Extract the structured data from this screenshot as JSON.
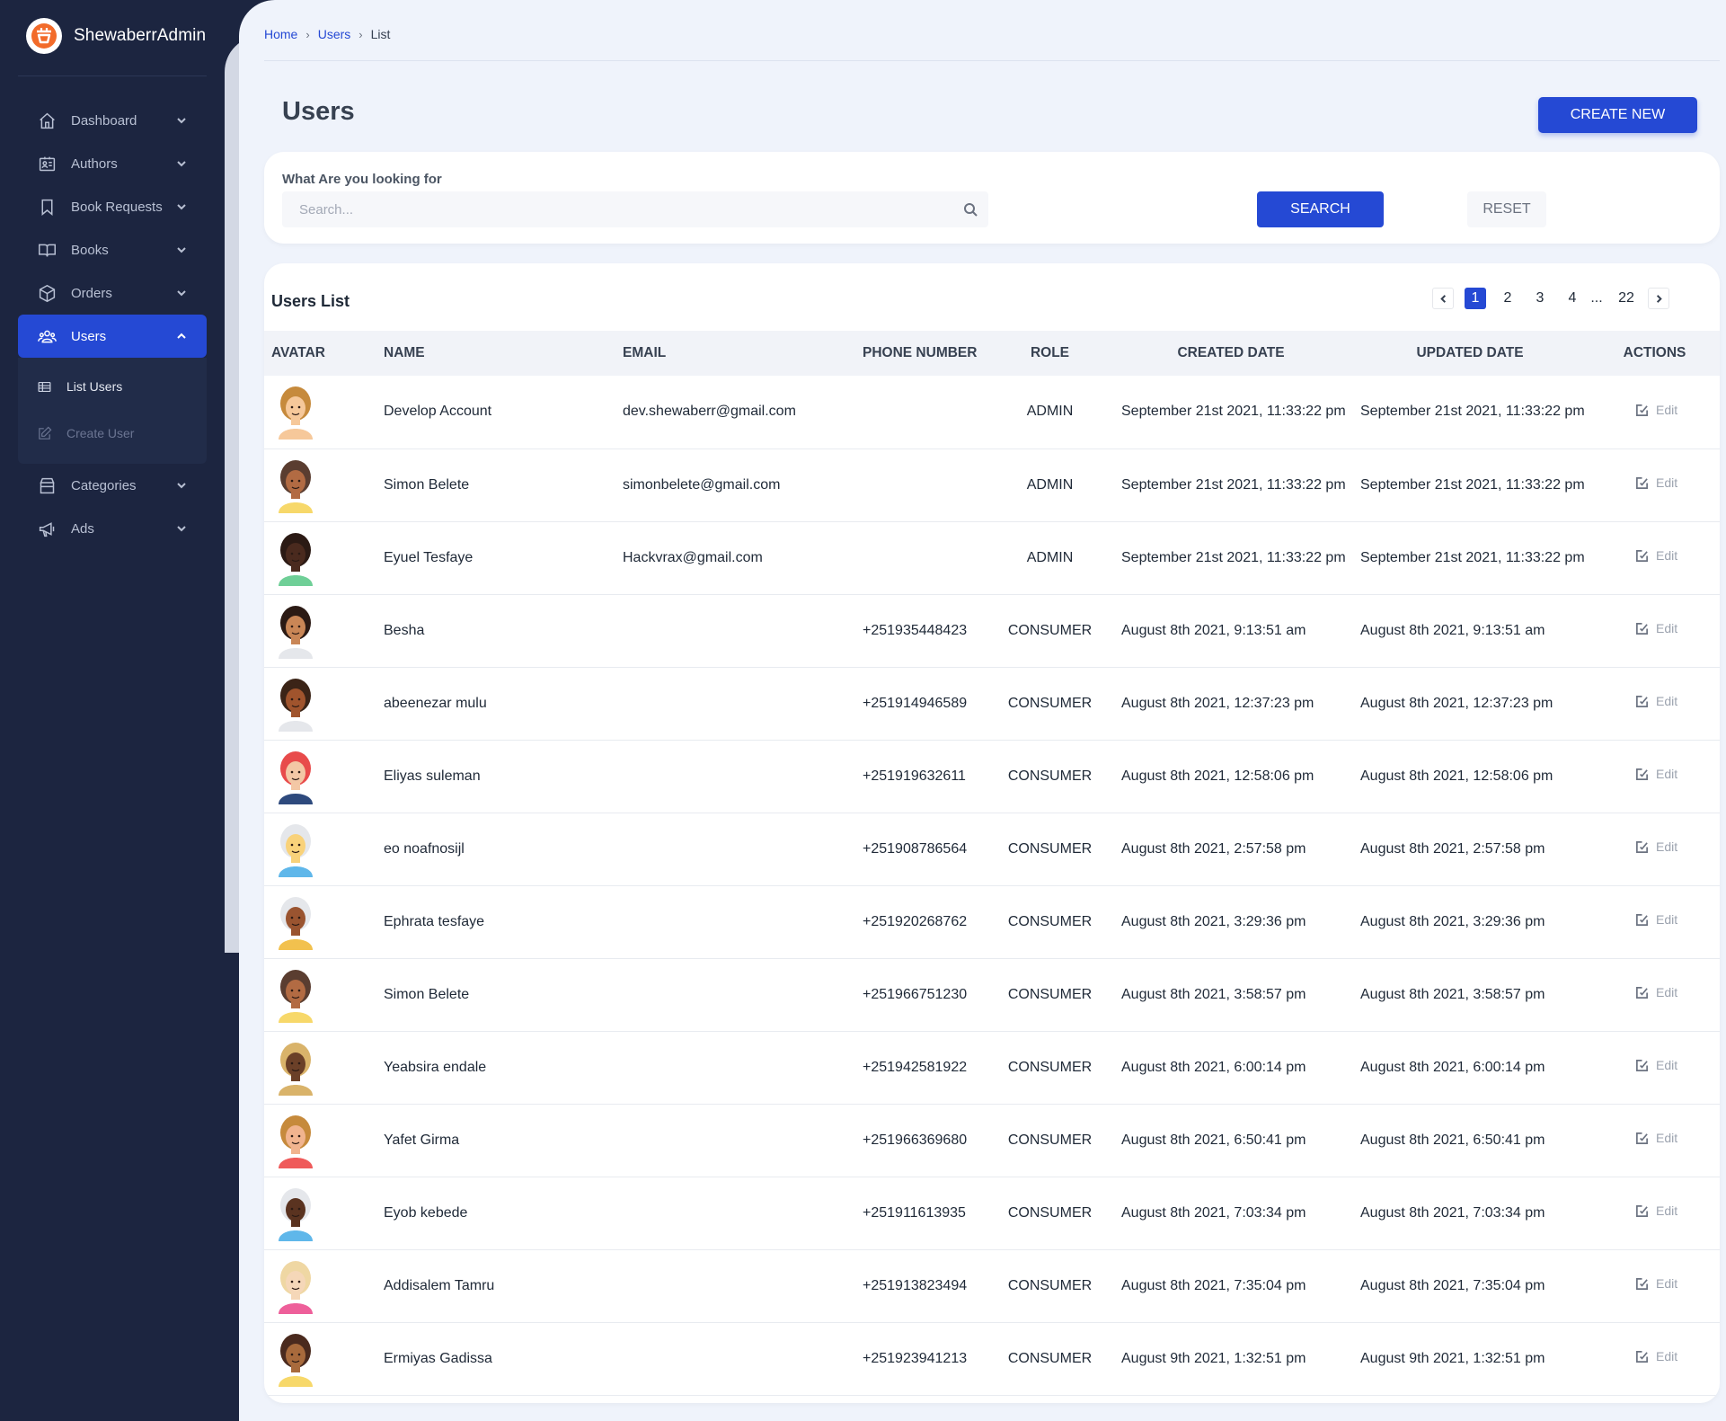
{
  "brand": {
    "name": "ShewaberrAdmin",
    "logo_icon": "shewaberr-logo-icon"
  },
  "colors": {
    "primary": "#2549d4",
    "sidebar_bg": "#1c2540",
    "page_bg": "#eff3fb"
  },
  "sidebar": {
    "items": [
      {
        "label": "Dashboard",
        "icon": "home-icon"
      },
      {
        "label": "Authors",
        "icon": "id-card-icon"
      },
      {
        "label": "Book Requests",
        "icon": "bookmark-icon"
      },
      {
        "label": "Books",
        "icon": "book-open-icon"
      },
      {
        "label": "Orders",
        "icon": "cube-icon"
      },
      {
        "label": "Users",
        "icon": "users-icon",
        "active": true
      },
      {
        "label": "Categories",
        "icon": "archive-icon"
      },
      {
        "label": "Ads",
        "icon": "megaphone-icon"
      }
    ],
    "users_submenu": [
      {
        "label": "List Users",
        "icon": "table-icon"
      },
      {
        "label": "Create User",
        "icon": "edit-icon"
      }
    ]
  },
  "breadcrumb": {
    "home": "Home",
    "users": "Users",
    "current": "List"
  },
  "page": {
    "title": "Users",
    "create_label": "CREATE NEW"
  },
  "search": {
    "question": "What Are you looking for",
    "placeholder": "Search...",
    "value": "",
    "search_label": "SEARCH",
    "reset_label": "RESET"
  },
  "list": {
    "title": "Users List",
    "pagination": {
      "pages": [
        "1",
        "2",
        "3",
        "4"
      ],
      "ellipsis": "...",
      "last": "22",
      "current": "1"
    },
    "columns": {
      "avatar": "AVATAR",
      "name": "NAME",
      "email": "EMAIL",
      "phone": "PHONE NUMBER",
      "role": "ROLE",
      "created": "CREATED DATE",
      "updated": "UPDATED DATE",
      "actions": "ACTIONS"
    },
    "edit_label": "Edit",
    "rows": [
      {
        "name": "Develop Account",
        "email": "dev.shewaberr@gmail.com",
        "phone": "",
        "role": "ADMIN",
        "created": "September 21st 2021, 11:33:22 pm",
        "updated": "September 21st 2021, 11:33:22 pm",
        "avatar": {
          "skin": "#f6c89a",
          "hair": "#c68a3c",
          "shirt": "#f6c89a"
        }
      },
      {
        "name": "Simon Belete",
        "email": "simonbelete@gmail.com",
        "phone": "",
        "role": "ADMIN",
        "created": "September 21st 2021, 11:33:22 pm",
        "updated": "September 21st 2021, 11:33:22 pm",
        "avatar": {
          "skin": "#b26b43",
          "hair": "#5a3d30",
          "shirt": "#f7d86a"
        }
      },
      {
        "name": "Eyuel Tesfaye",
        "email": "Hackvrax@gmail.com",
        "phone": "",
        "role": "ADMIN",
        "created": "September 21st 2021, 11:33:22 pm",
        "updated": "September 21st 2021, 11:33:22 pm",
        "avatar": {
          "skin": "#4a2a1e",
          "hair": "#2b1a14",
          "shirt": "#6fcf97"
        }
      },
      {
        "name": "Besha",
        "email": "",
        "phone": "+251935448423",
        "role": "CONSUMER",
        "created": "August 8th 2021, 9:13:51 am",
        "updated": "August 8th 2021, 9:13:51 am",
        "avatar": {
          "skin": "#c98656",
          "hair": "#2b1a14",
          "shirt": "#e5e7eb"
        }
      },
      {
        "name": "abeenezar mulu",
        "email": "",
        "phone": "+251914946589",
        "role": "CONSUMER",
        "created": "August 8th 2021, 12:37:23 pm",
        "updated": "August 8th 2021, 12:37:23 pm",
        "avatar": {
          "skin": "#a0542d",
          "hair": "#3b2417",
          "shirt": "#e5e7eb"
        }
      },
      {
        "name": "Eliyas suleman",
        "email": "",
        "phone": "+251919632611",
        "role": "CONSUMER",
        "created": "August 8th 2021, 12:58:06 pm",
        "updated": "August 8th 2021, 12:58:06 pm",
        "avatar": {
          "skin": "#f3c7a5",
          "hair": "#e84b4b",
          "shirt": "#2e4a7d"
        }
      },
      {
        "name": "eo noafnosijl",
        "email": "",
        "phone": "+251908786564",
        "role": "CONSUMER",
        "created": "August 8th 2021, 2:57:58 pm",
        "updated": "August 8th 2021, 2:57:58 pm",
        "avatar": {
          "skin": "#f9d27a",
          "hair": "#e5e7eb",
          "shirt": "#5fb7ea"
        }
      },
      {
        "name": "Ephrata tesfaye",
        "email": "",
        "phone": "+251920268762",
        "role": "CONSUMER",
        "created": "August 8th 2021, 3:29:36 pm",
        "updated": "August 8th 2021, 3:29:36 pm",
        "avatar": {
          "skin": "#9a5430",
          "hair": "#e5e7eb",
          "shirt": "#f2c14e"
        }
      },
      {
        "name": "Simon Belete",
        "email": "",
        "phone": "+251966751230",
        "role": "CONSUMER",
        "created": "August 8th 2021, 3:58:57 pm",
        "updated": "August 8th 2021, 3:58:57 pm",
        "avatar": {
          "skin": "#b26b43",
          "hair": "#5a3d30",
          "shirt": "#f7d86a"
        }
      },
      {
        "name": "Yeabsira endale",
        "email": "",
        "phone": "+251942581922",
        "role": "CONSUMER",
        "created": "August 8th 2021, 6:00:14 pm",
        "updated": "August 8th 2021, 6:00:14 pm",
        "avatar": {
          "skin": "#6b4028",
          "hair": "#d9b36a",
          "shirt": "#d9b36a"
        }
      },
      {
        "name": "Yafet Girma",
        "email": "",
        "phone": "+251966369680",
        "role": "CONSUMER",
        "created": "August 8th 2021, 6:50:41 pm",
        "updated": "August 8th 2021, 6:50:41 pm",
        "avatar": {
          "skin": "#f1b48f",
          "hair": "#c68a3c",
          "shirt": "#ef5a5a"
        }
      },
      {
        "name": "Eyob kebede",
        "email": "",
        "phone": "+251911613935",
        "role": "CONSUMER",
        "created": "August 8th 2021, 7:03:34 pm",
        "updated": "August 8th 2021, 7:03:34 pm",
        "avatar": {
          "skin": "#5a3320",
          "hair": "#e5e7eb",
          "shirt": "#5fb7ea"
        }
      },
      {
        "name": "Addisalem Tamru",
        "email": "",
        "phone": "+251913823494",
        "role": "CONSUMER",
        "created": "August 8th 2021, 7:35:04 pm",
        "updated": "August 8th 2021, 7:35:04 pm",
        "avatar": {
          "skin": "#f5d7b8",
          "hair": "#efd7a3",
          "shirt": "#ee5f9a"
        }
      },
      {
        "name": "Ermiyas Gadissa",
        "email": "",
        "phone": "+251923941213",
        "role": "CONSUMER",
        "created": "August 9th 2021, 1:32:51 pm",
        "updated": "August 9th 2021, 1:32:51 pm",
        "avatar": {
          "skin": "#a86a3c",
          "hair": "#4a2a1e",
          "shirt": "#f7d86a"
        }
      }
    ]
  }
}
